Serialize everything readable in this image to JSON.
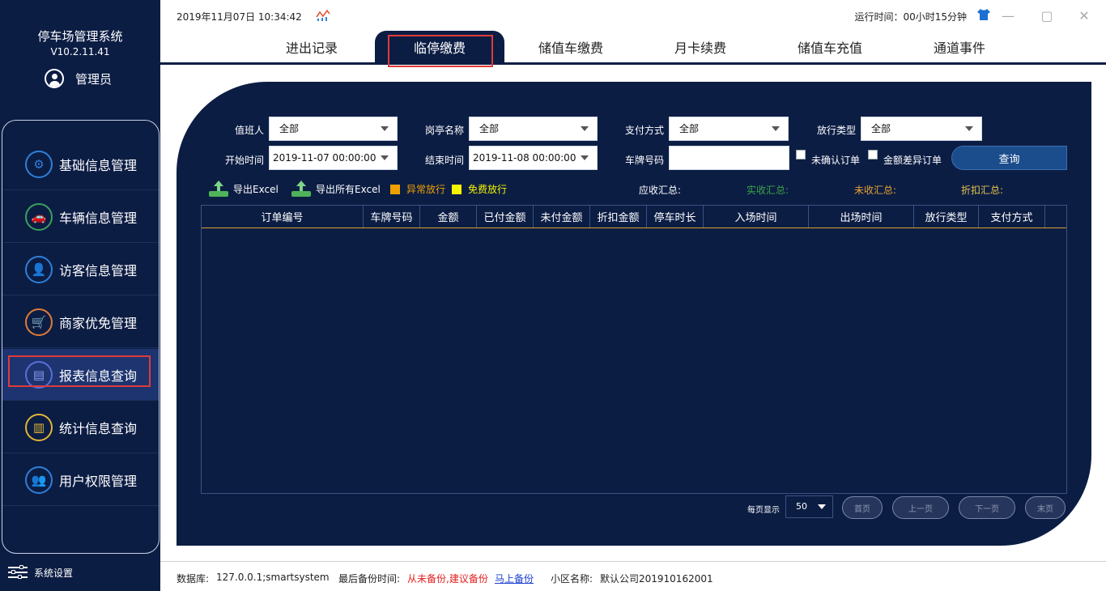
{
  "app": {
    "title": "停车场管理系统",
    "version": "V10.2.11.41",
    "user": "管理员"
  },
  "sidebar": {
    "items": [
      {
        "label": "基础信息管理",
        "icon": "gear-icon",
        "color": "#2f7fd8"
      },
      {
        "label": "车辆信息管理",
        "icon": "car-icon",
        "color": "#39a05a"
      },
      {
        "label": "访客信息管理",
        "icon": "visitor-icon",
        "color": "#2f7fd8"
      },
      {
        "label": "商家优免管理",
        "icon": "cart-icon",
        "color": "#e07c36"
      },
      {
        "label": "报表信息查询",
        "icon": "report-icon",
        "color": "#5a6fd8",
        "active": true
      },
      {
        "label": "统计信息查询",
        "icon": "stats-icon",
        "color": "#e2b535"
      },
      {
        "label": "用户权限管理",
        "icon": "users-icon",
        "color": "#2f7fd8"
      }
    ],
    "settings_label": "系统设置"
  },
  "topbar": {
    "datetime": "2019年11月07日 10:34:42",
    "runtime": "运行时间：00小时15分钟"
  },
  "tabs": [
    {
      "label": "进出记录"
    },
    {
      "label": "临停缴费",
      "active": true
    },
    {
      "label": "储值车缴费"
    },
    {
      "label": "月卡续费"
    },
    {
      "label": "储值车充值"
    },
    {
      "label": "通道事件"
    }
  ],
  "filters": {
    "duty_label": "值班人",
    "duty_value": "全部",
    "booth_label": "岗亭名称",
    "booth_value": "全部",
    "pay_label": "支付方式",
    "pay_value": "全部",
    "release_label": "放行类型",
    "release_value": "全部",
    "start_label": "开始时间",
    "start_value": "2019-11-07 00:00:00",
    "end_label": "结束时间",
    "end_value": "2019-11-08 00:00:00",
    "plate_label": "车牌号码",
    "plate_value": "",
    "unconfirmed_label": "未确认订单",
    "diff_label": "金额差异订单",
    "query_label": "查询"
  },
  "actions": {
    "export_excel": "导出Excel",
    "export_all_excel": "导出所有Excel",
    "legend_abnormal": "异常放行",
    "legend_free": "免费放行",
    "legend_abnormal_color": "#f0a000",
    "legend_free_color": "#f4f400"
  },
  "summary": {
    "receivable": "应收汇总:",
    "received": "实收汇总:",
    "unreceived": "未收汇总:",
    "discount": "折扣汇总:"
  },
  "table": {
    "columns": [
      "订单编号",
      "车牌号码",
      "金额",
      "已付金额",
      "未付金额",
      "折扣金额",
      "停车时长",
      "入场时间",
      "出场时间",
      "放行类型",
      "支付方式"
    ],
    "rows": []
  },
  "pager": {
    "label": "每页显示",
    "size": "50",
    "first": "首页",
    "prev": "上一页",
    "next": "下一页",
    "last": "末页"
  },
  "status": {
    "db_label": "数据库:",
    "db_value": "127.0.0.1;smartsystem",
    "backup_label": "最后备份时间:",
    "backup_value": "从未备份,建议备份",
    "backup_link": "马上备份",
    "community_label": "小区名称:",
    "community_value": "默认公司201910162001"
  }
}
